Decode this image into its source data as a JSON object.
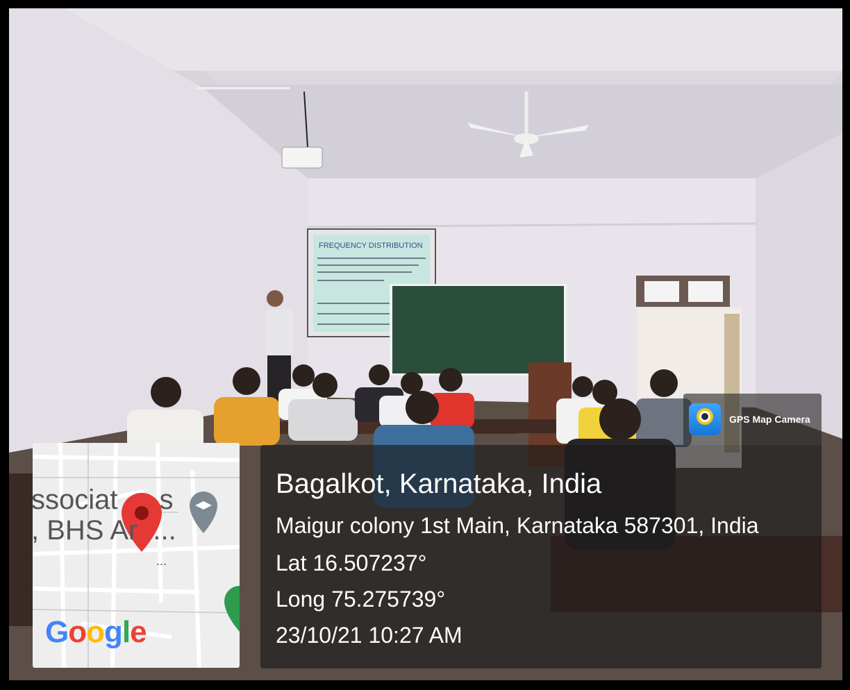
{
  "badge": {
    "label": "GPS Map Camera",
    "icon": "gps-map-camera-icon"
  },
  "location": {
    "city": "Bagalkot, Karnataka, India",
    "address": "Maigur colony 1st Main, Karnataka 587301, India",
    "lat": "Lat 16.507237°",
    "long": "Long 75.275739°",
    "datetime": "23/10/21 10:27 AM"
  },
  "map": {
    "label_line1": "ssociat",
    "label_line1_suffix": "s",
    "label_line2": ", BHS Ar",
    "label_line2_suffix": "...",
    "dots": "...",
    "google": [
      "G",
      "o",
      "o",
      "g",
      "l",
      "e"
    ],
    "google_colors": [
      "#4285F4",
      "#EA4335",
      "#FBBC05",
      "#4285F4",
      "#34A853",
      "#EA4335"
    ]
  },
  "slide": {
    "title": "FREQUENCY DISTRIBUTION"
  }
}
